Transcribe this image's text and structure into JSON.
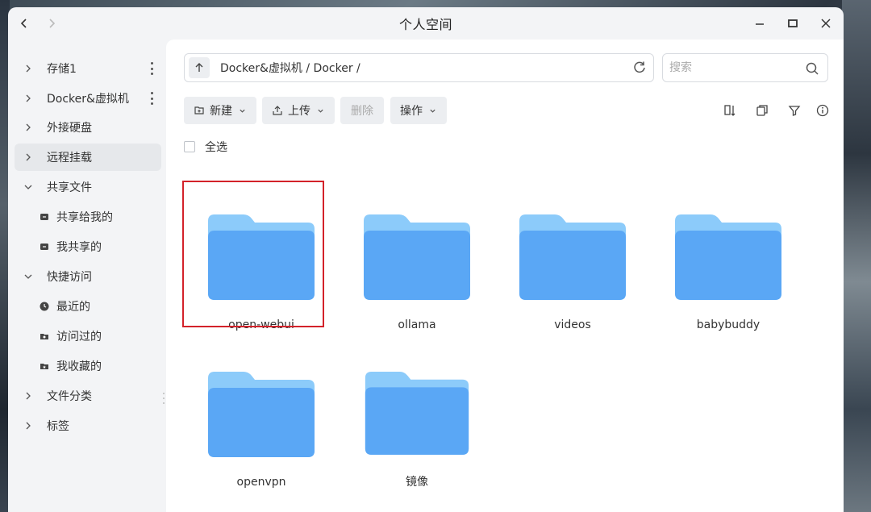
{
  "window": {
    "title": "个人空间"
  },
  "sidebar": {
    "items": [
      {
        "label": "存储1",
        "expanded": false,
        "has_more": true
      },
      {
        "label": "Docker&虚拟机",
        "expanded": false,
        "has_more": true
      },
      {
        "label": "外接硬盘",
        "expanded": false
      },
      {
        "label": "远程挂载",
        "expanded": false,
        "active": true
      },
      {
        "label": "共享文件",
        "expanded": true
      },
      {
        "label": "共享给我的",
        "sub": true
      },
      {
        "label": "我共享的",
        "sub": true
      },
      {
        "label": "快捷访问",
        "expanded": true
      },
      {
        "label": "最近的",
        "sub": true
      },
      {
        "label": "访问过的",
        "sub": true
      },
      {
        "label": "我收藏的",
        "sub": true
      },
      {
        "label": "文件分类",
        "expanded": false
      },
      {
        "label": "标签",
        "expanded": false
      }
    ]
  },
  "pathbar": {
    "path": "Docker&虚拟机 / Docker /"
  },
  "search": {
    "placeholder": "搜索"
  },
  "toolbar": {
    "new_label": "新建",
    "upload_label": "上传",
    "delete_label": "删除",
    "actions_label": "操作"
  },
  "select_all_label": "全选",
  "folders": [
    {
      "name": "open-webui",
      "highlighted": true
    },
    {
      "name": "ollama"
    },
    {
      "name": "videos"
    },
    {
      "name": "babybuddy"
    },
    {
      "name": "openvpn"
    },
    {
      "name": "镜像"
    }
  ],
  "colors": {
    "highlight": "#d3222a",
    "folder_front": "#5aa7f5",
    "folder_back": "#8ccbfa"
  }
}
